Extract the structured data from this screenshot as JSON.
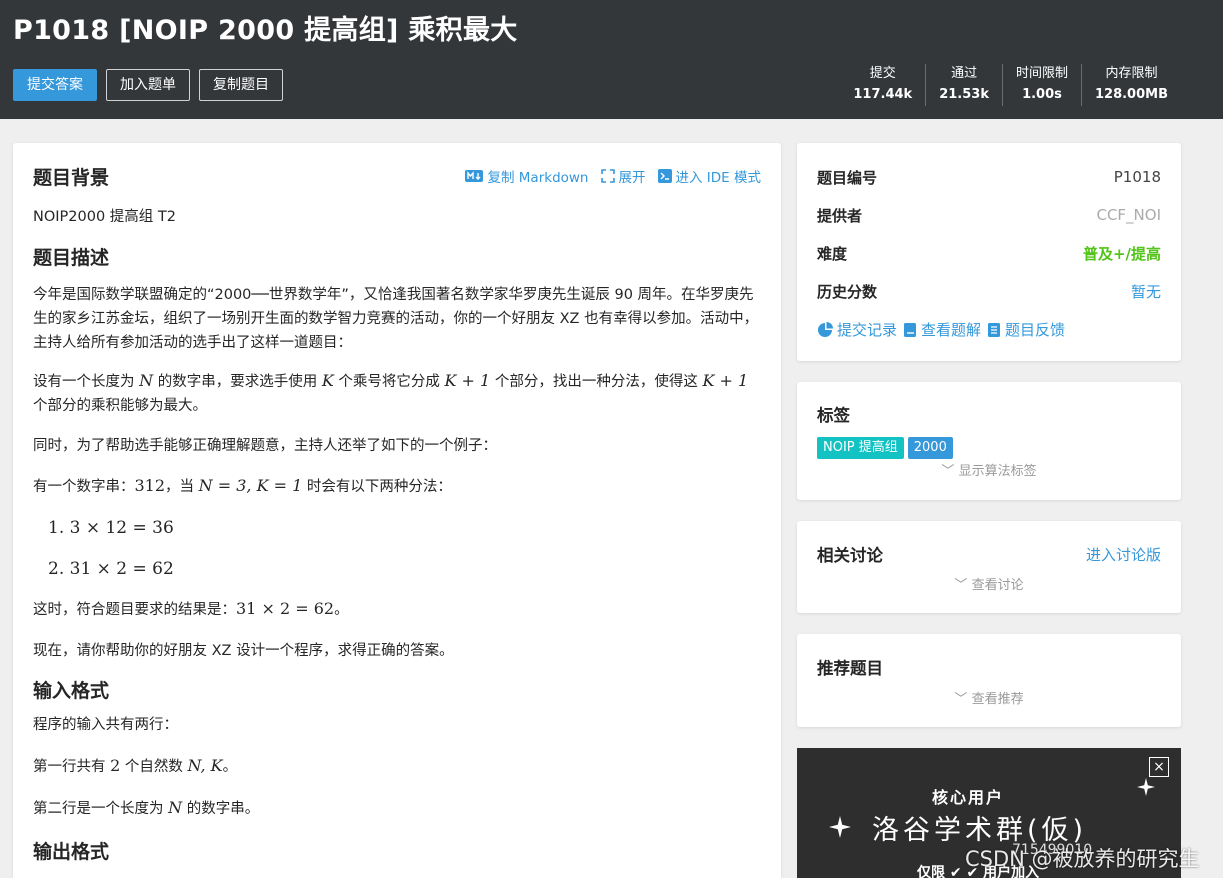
{
  "header": {
    "title": "P1018 [NOIP 2000 提高组] 乘积最大",
    "buttons": {
      "submit": "提交答案",
      "add_list": "加入题单",
      "copy": "复制题目"
    },
    "stats": [
      {
        "label": "提交",
        "value": "117.44k"
      },
      {
        "label": "通过",
        "value": "21.53k"
      },
      {
        "label": "时间限制",
        "value": "1.00s"
      },
      {
        "label": "内存限制",
        "value": "128.00MB"
      }
    ]
  },
  "toolbar": {
    "copy_md": "复制 Markdown",
    "expand": "展开",
    "ide": "进入 IDE 模式"
  },
  "problem": {
    "background_title": "题目背景",
    "background_text": "NOIP2000 提高组 T2",
    "desc_title": "题目描述",
    "desc_p1": "今年是国际数学联盟确定的“2000──世界数学年”，又恰逢我国著名数学家华罗庚先生诞辰 90 周年。在华罗庚先生的家乡江苏金坛，组织了一场别开生面的数学智力竞赛的活动，你的一个好朋友 XZ 也有幸得以参加。活动中，主持人给所有参加活动的选手出了这样一道题目：",
    "desc_p2_a": "设有一个长度为",
    "desc_p2_b": "的数字串，要求选手使用",
    "desc_p2_c": "个乘号将它分成",
    "desc_p2_d": "个部分，找出一种分法，使得这",
    "desc_p2_e": "个部分的乘积能够为最大。",
    "desc_p3": "同时，为了帮助选手能够正确理解题意，主持人还举了如下的一个例子：",
    "desc_p4_a": "有一个数字串：",
    "desc_p4_num": "312",
    "desc_p4_b": "，当",
    "desc_p4_c": "时会有以下两种分法：",
    "list1": "1. 3 × 12 = 36",
    "list2": "2. 31 × 2 = 62",
    "desc_p5_a": "这时，符合题目要求的结果是：",
    "desc_p5_expr": "31 × 2 = 62",
    "desc_p5_b": "。",
    "desc_p6": "现在，请你帮助你的好朋友 XZ 设计一个程序，求得正确的答案。",
    "input_title": "输入格式",
    "input_p1": "程序的输入共有两行：",
    "input_p2_a": "第一行共有",
    "input_p2_num": "2",
    "input_p2_b": "个自然数",
    "input_p2_c": "。",
    "input_p3_a": "第二行是一个长度为",
    "input_p3_b": "的数字串。",
    "output_title": "输出格式",
    "math": {
      "N": "N",
      "K": "K",
      "K1": "K + 1",
      "NK": "N = 3, K = 1",
      "NKlist": "N, K"
    }
  },
  "info": {
    "id_label": "题目编号",
    "id_value": "P1018",
    "provider_label": "提供者",
    "provider_value": "CCF_NOI",
    "difficulty_label": "难度",
    "difficulty_value": "普及+/提高",
    "history_label": "历史分数",
    "history_value": "暂无",
    "links": {
      "records": "提交记录",
      "solutions": "查看题解",
      "feedback": "题目反馈"
    }
  },
  "tags": {
    "title": "标签",
    "items": [
      {
        "text": "NOIP 提高组",
        "color": "#13c2c2"
      },
      {
        "text": "2000",
        "color": "#3498db"
      }
    ],
    "show_more": "显示算法标签"
  },
  "discuss": {
    "title": "相关讨论",
    "link": "进入讨论版",
    "more": "查看讨论"
  },
  "recommend": {
    "title": "推荐题目",
    "more": "查看推荐"
  },
  "ad": {
    "close": "×",
    "line1": "核心用户",
    "line2": "洛谷学术群(仮)",
    "line3": "715499010",
    "line4": "仅限 ✔ ✔ 用户加入"
  },
  "watermark": "CSDN @被放养的研究生",
  "colors": {
    "header_bg": "#34373a",
    "accent": "#3498db",
    "difficulty": "#52c41a",
    "page_bg": "#efefef"
  }
}
